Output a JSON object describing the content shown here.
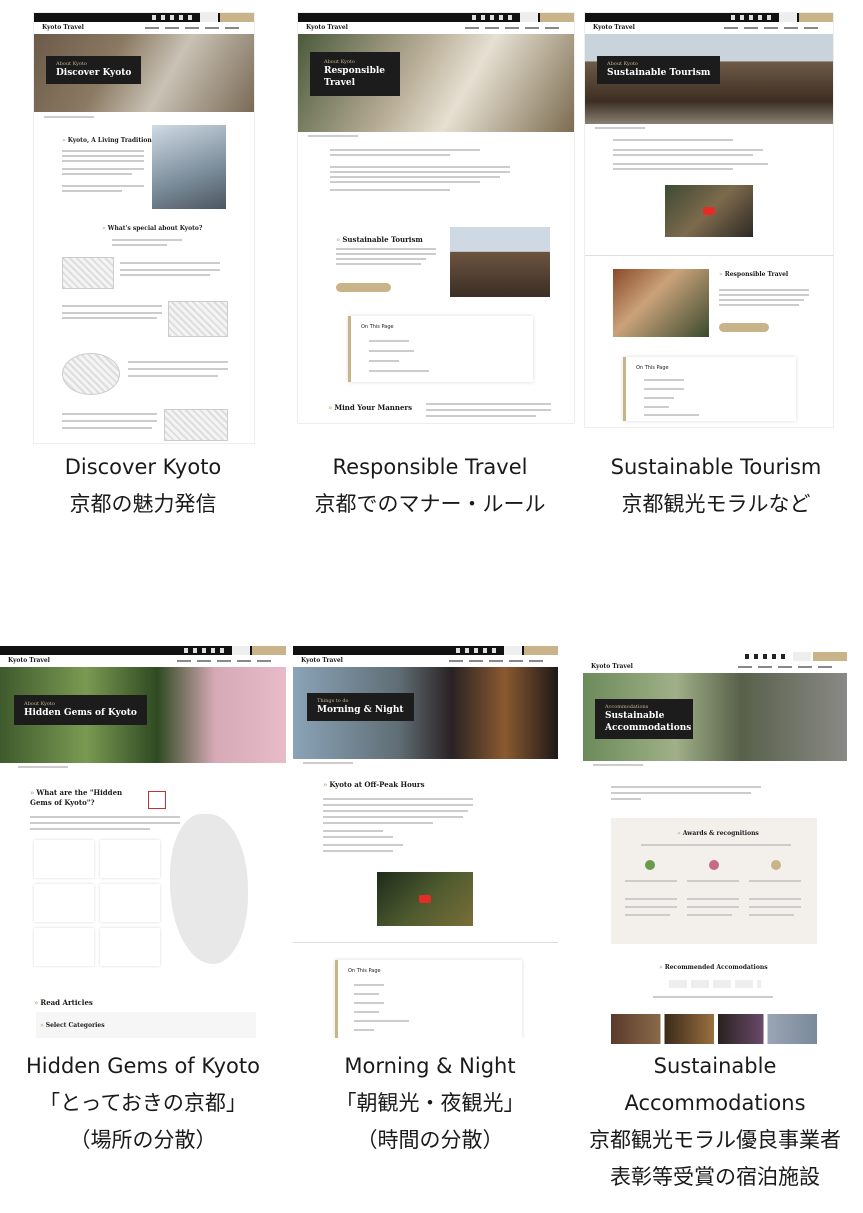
{
  "tiles": [
    {
      "caption": [
        "Discover Kyoto",
        "京都の魅力発信"
      ],
      "hero": {
        "small": "About Kyoto",
        "title": "Discover Kyoto"
      },
      "headings": [
        "Kyoto, A Living Tradition",
        "What's special about Kyoto?"
      ]
    },
    {
      "caption": [
        "Responsible Travel",
        "京都でのマナー・ルール"
      ],
      "hero": {
        "small": "About Kyoto",
        "title": "Responsible Travel"
      },
      "headings": [
        "Sustainable Tourism",
        "On This Page",
        "Mind Your Manners"
      ]
    },
    {
      "caption": [
        "Sustainable Tourism",
        "京都観光モラルなど"
      ],
      "hero": {
        "small": "About Kyoto",
        "title": "Sustainable Tourism"
      },
      "headings": [
        "Responsible Travel",
        "On This Page"
      ]
    },
    {
      "caption": [
        "Hidden Gems of Kyoto",
        "「とっておきの京都」",
        "（場所の分散）"
      ],
      "hero": {
        "small": "About Kyoto",
        "title": "Hidden Gems of Kyoto"
      },
      "headings": [
        "What are the \"Hidden Gems of Kyoto\"?",
        "Read Articles",
        "Select Categories"
      ]
    },
    {
      "caption": [
        "Morning & Night",
        "「朝観光・夜観光」",
        "（時間の分散）"
      ],
      "hero": {
        "small": "Things to do",
        "title": "Morning & Night"
      },
      "headings": [
        "Kyoto at Off-Peak Hours",
        "On This Page"
      ]
    },
    {
      "caption": [
        "Sustainable",
        "Accommodations",
        "京都観光モラル優良事業者",
        "表彰等受賞の宿泊施設"
      ],
      "hero": {
        "small": "Accommodations",
        "title": "Sustainable Accommodations"
      },
      "headings": [
        "Awards & recognitions",
        "Recommended Accomodations"
      ]
    }
  ],
  "site": {
    "logo": "Kyoto Travel"
  },
  "colors": {
    "accent": "#c9b48a",
    "dark": "#1c1c1c"
  }
}
